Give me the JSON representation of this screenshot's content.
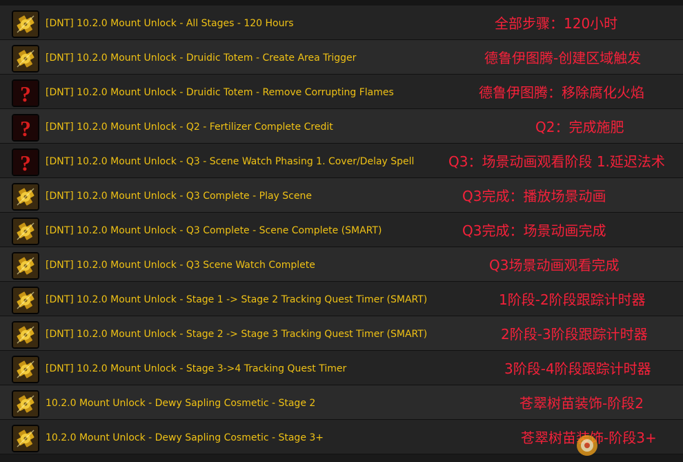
{
  "rows": [
    {
      "icon": "gold-cog-icon",
      "name": "[DNT] 10.2.0 Mount Unlock - All Stages - 120 Hours",
      "note": "全部步骤：120小时"
    },
    {
      "icon": "gold-cog-icon",
      "name": "[DNT] 10.2.0 Mount Unlock - Druidic Totem - Create Area Trigger",
      "note": "德鲁伊图腾-创建区域触发"
    },
    {
      "icon": "red-question-mark-icon",
      "name": "[DNT] 10.2.0 Mount Unlock - Druidic Totem - Remove Corrupting Flames",
      "note": "德鲁伊图腾：移除腐化火焰"
    },
    {
      "icon": "red-question-mark-icon",
      "name": "[DNT] 10.2.0 Mount Unlock - Q2 - Fertilizer Complete Credit",
      "note": "Q2：完成施肥"
    },
    {
      "icon": "red-question-mark-icon",
      "name": "[DNT] 10.2.0 Mount Unlock - Q3 - Scene Watch Phasing 1. Cover/Delay Spell",
      "note": "Q3：场景动画观看阶段 1.延迟法术"
    },
    {
      "icon": "gold-cog-icon",
      "name": "[DNT] 10.2.0 Mount Unlock - Q3 Complete - Play Scene",
      "note": "Q3完成：播放场景动画"
    },
    {
      "icon": "gold-cog-icon",
      "name": "[DNT] 10.2.0 Mount Unlock - Q3 Complete - Scene Complete (SMART)",
      "note": "Q3完成：场景动画完成"
    },
    {
      "icon": "gold-cog-icon",
      "name": "[DNT] 10.2.0 Mount Unlock - Q3 Scene Watch Complete",
      "note": "Q3场景动画观看完成"
    },
    {
      "icon": "gold-cog-icon",
      "name": "[DNT] 10.2.0 Mount Unlock - Stage 1 -> Stage 2 Tracking Quest Timer (SMART)",
      "note": "1阶段-2阶段跟踪计时器"
    },
    {
      "icon": "gold-cog-icon",
      "name": "[DNT] 10.2.0 Mount Unlock - Stage 2 -> Stage 3 Tracking Quest Timer (SMART)",
      "note": "2阶段-3阶段跟踪计时器"
    },
    {
      "icon": "gold-cog-icon",
      "name": "[DNT] 10.2.0 Mount Unlock - Stage 3->4 Tracking Quest Timer",
      "note": "3阶段-4阶段跟踪计时器"
    },
    {
      "icon": "gold-cog-icon",
      "name": "10.2.0 Mount Unlock - Dewy Sapling Cosmetic - Stage 2",
      "note": "苍翠树苗装饰-阶段2"
    },
    {
      "icon": "gold-cog-icon",
      "name": "10.2.0 Mount Unlock - Dewy Sapling Cosmetic - Stage 3+",
      "note": "苍翠树苗装饰-阶段3+"
    }
  ],
  "colors": {
    "item_name": "#f0c215",
    "annotation": "#f5213a"
  }
}
